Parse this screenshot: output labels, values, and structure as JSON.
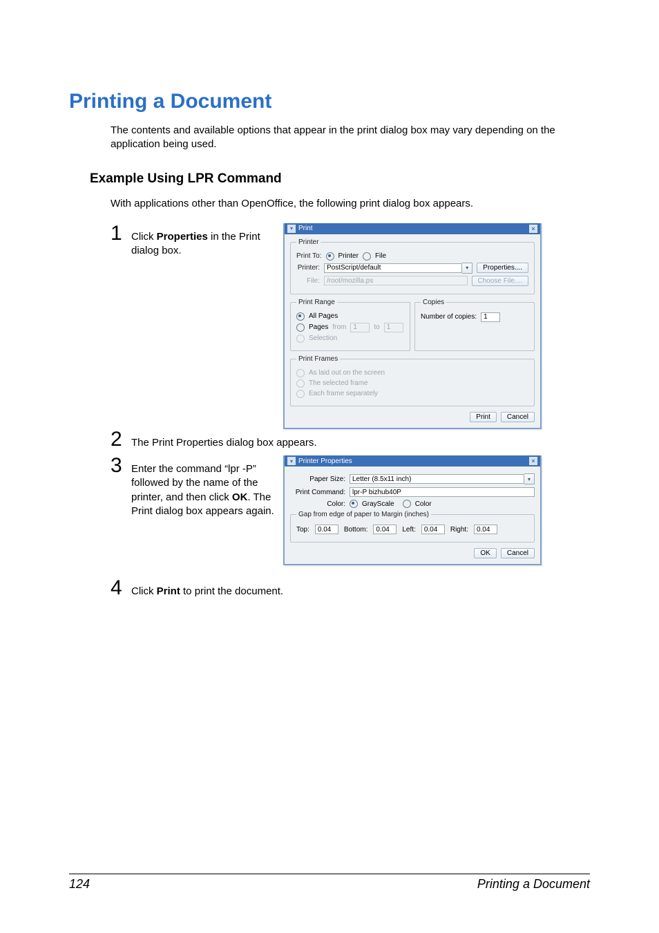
{
  "title": "Printing a Document",
  "intro": "The contents and available options that appear in the print dialog box may vary depending on the application being used.",
  "subhead": "Example Using LPR Command",
  "subintro": "With applications other than OpenOffice, the following print dialog box appears.",
  "steps": {
    "s1_num": "1",
    "s1_a": "Click ",
    "s1_b": "Properties",
    "s1_c": " in the Print dialog box.",
    "s2_num": "2",
    "s2": "The Print Properties dialog box appears.",
    "s3_num": "3",
    "s3_a": "Enter the command “lpr -P” followed by the name of the printer, and then click ",
    "s3_b": "OK",
    "s3_c": ". The Print dialog box appears again.",
    "s4_num": "4",
    "s4_a": "Click ",
    "s4_b": "Print",
    "s4_c": " to print the document."
  },
  "print_dialog": {
    "title": "Print",
    "grp_printer": "Printer",
    "print_to": "Print To:",
    "opt_printer": "Printer",
    "opt_file": "File",
    "lbl_printer": "Printer:",
    "printer_value": "PostScript/default",
    "btn_properties": "Properties....",
    "lbl_file": "File:",
    "file_value": "/root/mozilla.ps",
    "btn_choose": "Choose File....",
    "grp_range": "Print Range",
    "opt_all": "All Pages",
    "opt_pages": "Pages",
    "from": "from",
    "from_v": "1",
    "to": "to",
    "to_v": "1",
    "opt_selection": "Selection",
    "grp_copies": "Copies",
    "num_copies": "Number of copies:",
    "copies_v": "1",
    "grp_frames": "Print Frames",
    "opt_aslaid": "As laid out on the screen",
    "opt_selected_frame": "The selected frame",
    "opt_each_frame": "Each frame separately",
    "btn_print": "Print",
    "btn_cancel": "Cancel"
  },
  "pp_dialog": {
    "title": "Printer Properties",
    "paper_size_lbl": "Paper Size:",
    "paper_size_val": "Letter (8.5x11 inch)",
    "cmd_lbl": "Print Command:",
    "cmd_val": "lpr-P bizhub40P",
    "color_lbl": "Color:",
    "gray": "GrayScale",
    "color": "Color",
    "gap_legend": "Gap from edge of paper to Margin (inches)",
    "top": "Top:",
    "bottom": "Bottom:",
    "left": "Left:",
    "right": "Right:",
    "val": "0.04",
    "ok": "OK",
    "cancel": "Cancel"
  },
  "footer": {
    "page": "124",
    "right": "Printing a Document"
  }
}
